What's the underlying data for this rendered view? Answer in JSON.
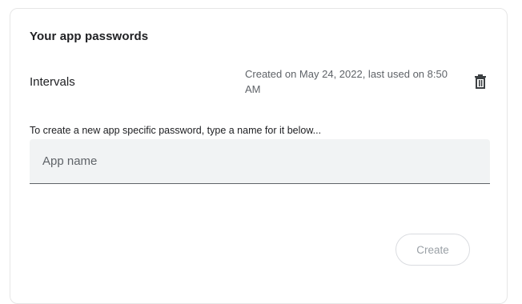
{
  "section": {
    "title": "Your app passwords"
  },
  "passwords": [
    {
      "name": "Intervals",
      "meta": "Created on May 24, 2022, last used on 8:50 AM",
      "delete_icon": "trash-icon"
    }
  ],
  "create_form": {
    "helper_text": "To create a new app specific password, type a name for it below...",
    "input_placeholder": "App name",
    "input_value": "",
    "create_label": "Create"
  },
  "colors": {
    "input_bg": "#f1f3f4",
    "underline": "#5f6368",
    "disabled_text": "#9aa0a6",
    "border": "#dadce0"
  }
}
